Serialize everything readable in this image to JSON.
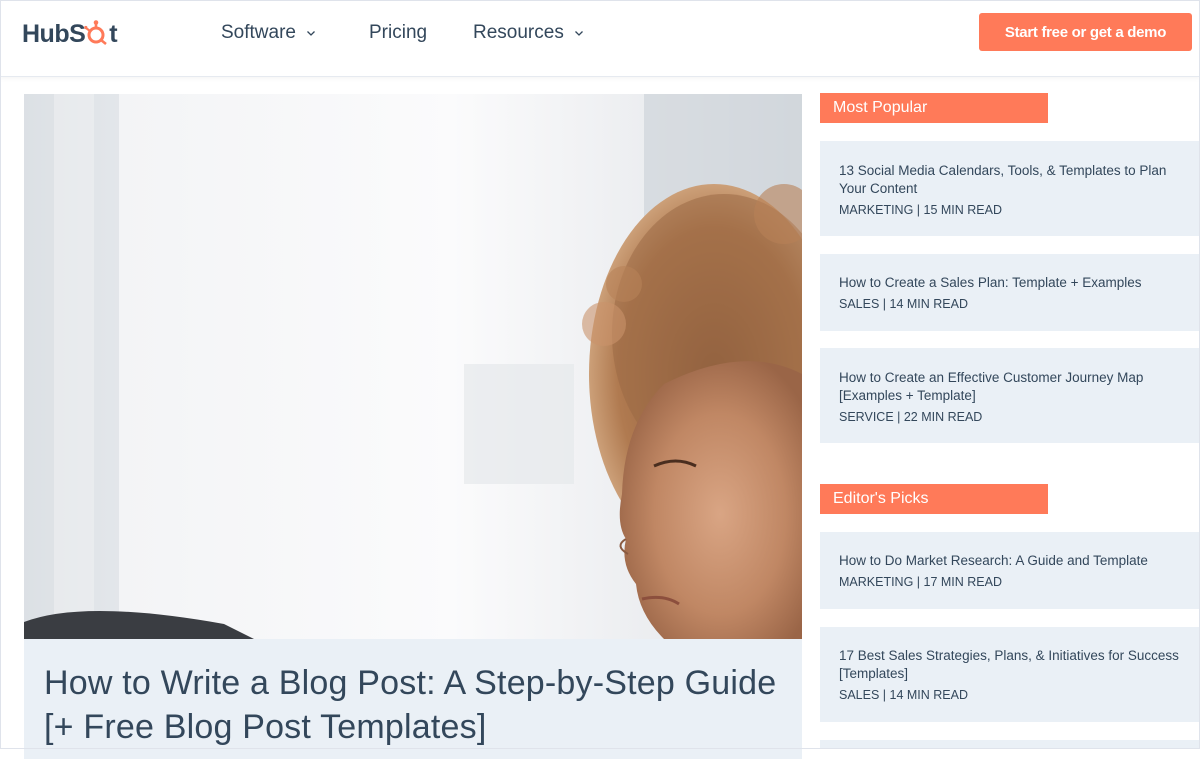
{
  "header": {
    "logo": {
      "text_a": "HubS",
      "text_b": "t",
      "brand_color": "#ff7a59"
    },
    "nav": [
      {
        "label": "Software",
        "has_dropdown": true
      },
      {
        "label": "Pricing",
        "has_dropdown": false
      },
      {
        "label": "Resources",
        "has_dropdown": true
      }
    ],
    "cta_label": "Start free or get a demo"
  },
  "article": {
    "title": "How to Write a Blog Post: A Step-by-Step Guide [+ Free Blog Post Templates]"
  },
  "sidebar": {
    "most_popular": {
      "heading": "Most Popular",
      "items": [
        {
          "title": "13 Social Media Calendars, Tools, & Templates to Plan Your Content",
          "meta": "MARKETING | 15 MIN READ"
        },
        {
          "title": "How to Create a Sales Plan: Template + Examples",
          "meta": "SALES | 14 MIN READ"
        },
        {
          "title": "How to Create an Effective Customer Journey Map [Examples + Template]",
          "meta": "SERVICE | 22 MIN READ"
        }
      ]
    },
    "editors_picks": {
      "heading": "Editor's Picks",
      "items": [
        {
          "title": "How to Do Market Research: A Guide and Template",
          "meta": "MARKETING | 17 MIN READ"
        },
        {
          "title": "17 Best Sales Strategies, Plans, & Initiatives for Success [Templates]",
          "meta": "SALES | 14 MIN READ"
        }
      ]
    }
  },
  "colors": {
    "accent": "#ff7a59",
    "text": "#33475b",
    "card_bg": "#eaf0f6"
  }
}
